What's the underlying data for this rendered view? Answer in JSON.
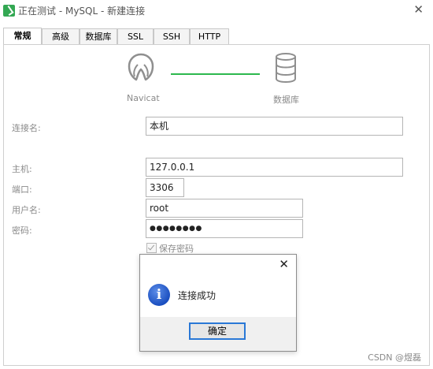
{
  "window": {
    "title": "正在测试 - MySQL - 新建连接",
    "close_glyph": "✕"
  },
  "tabs": [
    {
      "label": "常规",
      "active": true
    },
    {
      "label": "高级",
      "active": false
    },
    {
      "label": "数据库",
      "active": false
    },
    {
      "label": "SSL",
      "active": false
    },
    {
      "label": "SSH",
      "active": false
    },
    {
      "label": "HTTP",
      "active": false
    }
  ],
  "connection_graphic": {
    "left_label": "Navicat",
    "right_label": "数据库",
    "line_color": "#2db84e"
  },
  "form": {
    "connection_name": {
      "label": "连接名:",
      "value": "本机"
    },
    "host": {
      "label": "主机:",
      "value": "127.0.0.1"
    },
    "port": {
      "label": "端口:",
      "value": "3306"
    },
    "username": {
      "label": "用户名:",
      "value": "root"
    },
    "password": {
      "label": "密码:",
      "value": "●●●●●●●●"
    },
    "save_password": {
      "label": "保存密码",
      "checked": true
    }
  },
  "dialog": {
    "close_glyph": "✕",
    "icon": "info-icon",
    "icon_glyph": "i",
    "message": "连接成功",
    "ok_label": "确定",
    "accent_color": "#2a78d6"
  },
  "watermark": "CSDN @煜磊"
}
